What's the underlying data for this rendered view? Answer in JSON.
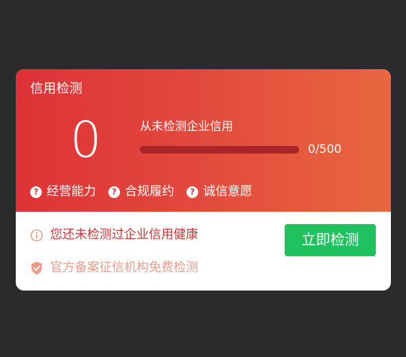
{
  "card": {
    "title": "信用检测",
    "score": "0",
    "status_text": "从未检测企业信用",
    "progress": {
      "value": 0,
      "max": 500,
      "label": "0/500"
    },
    "tags": [
      {
        "icon": "question-icon",
        "label": "经营能力"
      },
      {
        "icon": "question-icon",
        "label": "合规履约"
      },
      {
        "icon": "question-icon",
        "label": "诚信意愿"
      }
    ],
    "notice": {
      "icon": "info-icon",
      "text": "您还未检测过企业信用健康"
    },
    "sub_notice": {
      "icon": "shield-check-icon",
      "text": "官方备案征信机构免费检测"
    },
    "action_button": "立即检测"
  },
  "colors": {
    "background": "#2b2a2d",
    "gradient_start": "#de3236",
    "gradient_end": "#e9673f",
    "button": "#1fc25f",
    "notice_text": "#c63a3a",
    "sub_notice_text": "#e59f8f"
  }
}
